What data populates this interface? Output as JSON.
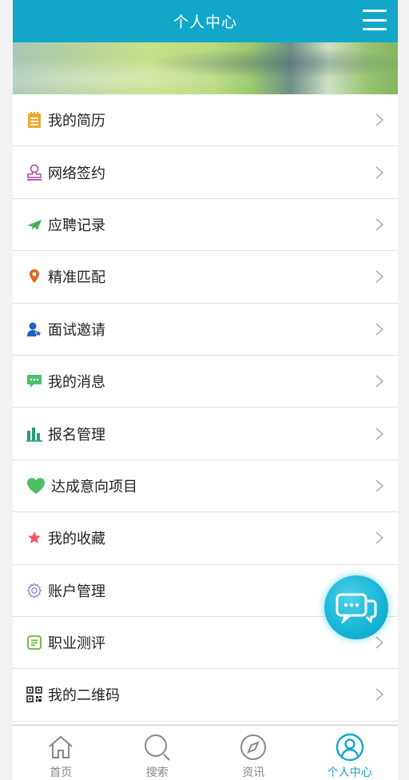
{
  "header": {
    "title": "个人中心",
    "menu_icon": "hamburger-menu-icon"
  },
  "menu": [
    {
      "label": "我的简历",
      "icon": "resume-icon",
      "color": "#f0a830"
    },
    {
      "label": "网络签约",
      "icon": "stamp-icon",
      "color": "#b04aa8"
    },
    {
      "label": "应聘记录",
      "icon": "paper-plane-icon",
      "color": "#52b560"
    },
    {
      "label": "精准匹配",
      "icon": "location-pin-icon",
      "color": "#e0651e"
    },
    {
      "label": "面试邀请",
      "icon": "user-star-icon",
      "color": "#1f5fc9"
    },
    {
      "label": "我的消息",
      "icon": "chat-bubble-icon",
      "color": "#4cc067"
    },
    {
      "label": "报名管理",
      "icon": "bar-chart-icon",
      "color": "#2a9a7a"
    },
    {
      "label": "达成意向项目",
      "icon": "heart-icon",
      "color": "#4cc067"
    },
    {
      "label": "我的收藏",
      "icon": "star-icon",
      "color": "#ec5a6a"
    },
    {
      "label": "账户管理",
      "icon": "gear-icon",
      "color": "#9b80c9"
    },
    {
      "label": "职业测评",
      "icon": "document-icon",
      "color": "#6cb23a"
    },
    {
      "label": "我的二维码",
      "icon": "qr-code-icon",
      "color": "#222222"
    }
  ],
  "tabbar": [
    {
      "label": "首页",
      "icon": "home-icon",
      "active": false
    },
    {
      "label": "搜索",
      "icon": "search-icon",
      "active": false
    },
    {
      "label": "资讯",
      "icon": "compass-icon",
      "active": false
    },
    {
      "label": "个人中心",
      "icon": "user-circle-icon",
      "active": true
    }
  ],
  "colors": {
    "accent": "#12a7c9",
    "inactive": "#888888"
  }
}
